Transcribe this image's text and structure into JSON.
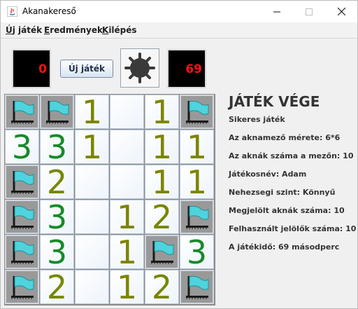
{
  "window": {
    "title": "Akanakereső"
  },
  "menu": [
    {
      "mnemonic": "Ú",
      "rest": "j játék"
    },
    {
      "mnemonic": "E",
      "rest": "redmények"
    },
    {
      "mnemonic": "K",
      "rest": "ilépés"
    }
  ],
  "toolbar": {
    "mine_counter": "0",
    "new_game_label": "Új játék",
    "timer": "69",
    "center_icon": "mine-icon"
  },
  "board": {
    "rows": 6,
    "cols": 6,
    "cells": [
      [
        "F",
        "F",
        "1",
        "",
        "1",
        "F"
      ],
      [
        "3",
        "3",
        "1",
        "",
        "1",
        "1"
      ],
      [
        "F",
        "2",
        "",
        "",
        "1",
        "1"
      ],
      [
        "F",
        "3",
        "",
        "1",
        "2",
        "F"
      ],
      [
        "F",
        "3",
        "",
        "1",
        "F",
        "3"
      ],
      [
        "F",
        "2",
        "",
        "1",
        "2",
        "F"
      ]
    ],
    "flag_icon": "flag-icon",
    "number_colors": {
      "1": "#7c8500",
      "2": "#768700",
      "3": "#178a2a"
    }
  },
  "info": {
    "title": "JÁTÉK VÉGE",
    "result": "Sikeres játék",
    "board_size": "Az aknamező mérete: 6*6",
    "mine_count": "Az aknák száma a mezőn: 10",
    "player": "Játékosnév: Adam",
    "difficulty": "Nehezsegi szint: Könnyű",
    "marked": "Megjelölt aknák száma: 10",
    "used_flags": "Felhasznált jelölők száma: 10",
    "time": "A játékidő: 69 másodperc"
  }
}
